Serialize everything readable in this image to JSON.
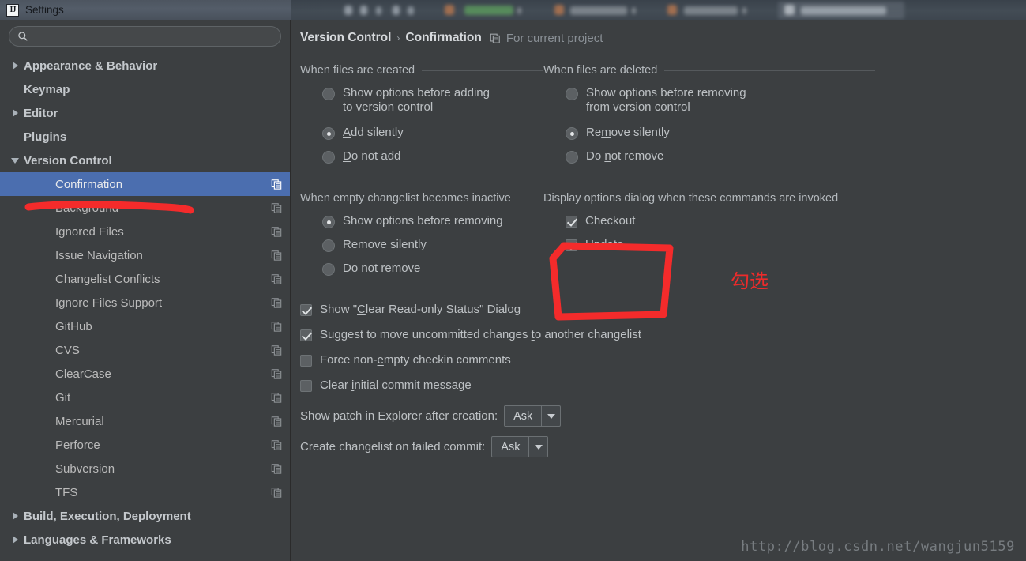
{
  "window": {
    "title": "Settings",
    "app_icon": "IJ"
  },
  "search": {
    "value": "",
    "placeholder": ""
  },
  "sidebar": {
    "items": [
      {
        "label": "Appearance & Behavior",
        "level": 0,
        "group": true,
        "twisty": "collapsed",
        "selected": false,
        "icon": false
      },
      {
        "label": "Keymap",
        "level": 0,
        "group": true,
        "twisty": "none",
        "selected": false,
        "icon": false
      },
      {
        "label": "Editor",
        "level": 0,
        "group": true,
        "twisty": "collapsed",
        "selected": false,
        "icon": false
      },
      {
        "label": "Plugins",
        "level": 0,
        "group": true,
        "twisty": "none",
        "selected": false,
        "icon": false
      },
      {
        "label": "Version Control",
        "level": 0,
        "group": true,
        "twisty": "expanded",
        "selected": false,
        "icon": false
      },
      {
        "label": "Confirmation",
        "level": 1,
        "group": false,
        "twisty": "none",
        "selected": true,
        "icon": true
      },
      {
        "label": "Background",
        "level": 1,
        "group": false,
        "twisty": "none",
        "selected": false,
        "icon": true
      },
      {
        "label": "Ignored Files",
        "level": 1,
        "group": false,
        "twisty": "none",
        "selected": false,
        "icon": true
      },
      {
        "label": "Issue Navigation",
        "level": 1,
        "group": false,
        "twisty": "none",
        "selected": false,
        "icon": true
      },
      {
        "label": "Changelist Conflicts",
        "level": 1,
        "group": false,
        "twisty": "none",
        "selected": false,
        "icon": true
      },
      {
        "label": "Ignore Files Support",
        "level": 1,
        "group": false,
        "twisty": "none",
        "selected": false,
        "icon": true
      },
      {
        "label": "GitHub",
        "level": 1,
        "group": false,
        "twisty": "none",
        "selected": false,
        "icon": true
      },
      {
        "label": "CVS",
        "level": 1,
        "group": false,
        "twisty": "none",
        "selected": false,
        "icon": true
      },
      {
        "label": "ClearCase",
        "level": 1,
        "group": false,
        "twisty": "none",
        "selected": false,
        "icon": true
      },
      {
        "label": "Git",
        "level": 1,
        "group": false,
        "twisty": "none",
        "selected": false,
        "icon": true
      },
      {
        "label": "Mercurial",
        "level": 1,
        "group": false,
        "twisty": "none",
        "selected": false,
        "icon": true
      },
      {
        "label": "Perforce",
        "level": 1,
        "group": false,
        "twisty": "none",
        "selected": false,
        "icon": true
      },
      {
        "label": "Subversion",
        "level": 1,
        "group": false,
        "twisty": "none",
        "selected": false,
        "icon": true
      },
      {
        "label": "TFS",
        "level": 1,
        "group": false,
        "twisty": "none",
        "selected": false,
        "icon": true
      },
      {
        "label": "Build, Execution, Deployment",
        "level": 0,
        "group": true,
        "twisty": "collapsed",
        "selected": false,
        "icon": false
      },
      {
        "label": "Languages & Frameworks",
        "level": 0,
        "group": true,
        "twisty": "collapsed",
        "selected": false,
        "icon": false
      }
    ]
  },
  "breadcrumb": {
    "root": "Version Control",
    "separator": "›",
    "leaf": "Confirmation",
    "scope_note": "For current project"
  },
  "sections": {
    "files_created": {
      "title": "When files are created",
      "has_rule": true,
      "options": [
        {
          "label": "Show options before adding to version control",
          "checked": false,
          "mnemonic": ""
        },
        {
          "label": "Add silently",
          "checked": true,
          "mnemonic": "A"
        },
        {
          "label": "Do not add",
          "checked": false,
          "mnemonic": "D"
        }
      ]
    },
    "files_deleted": {
      "title": "When files are deleted",
      "has_rule": true,
      "options": [
        {
          "label": "Show options before removing from version control",
          "checked": false,
          "mnemonic": ""
        },
        {
          "label": "Remove silently",
          "checked": true,
          "mnemonic": "m"
        },
        {
          "label": "Do not remove",
          "checked": false,
          "mnemonic": "n"
        }
      ]
    },
    "empty_changelist": {
      "title": "When empty changelist becomes inactive",
      "has_rule": false,
      "options": [
        {
          "label": "Show options before removing",
          "checked": true
        },
        {
          "label": "Remove silently",
          "checked": false
        },
        {
          "label": "Do not remove",
          "checked": false
        }
      ]
    },
    "display_options": {
      "title": "Display options dialog when these commands are invoked",
      "has_rule": false,
      "options": [
        {
          "label": "Checkout",
          "checked": true
        },
        {
          "label": "Update",
          "checked": true
        }
      ]
    }
  },
  "checkboxes": [
    {
      "label": "Show \"Clear Read-only Status\" Dialog",
      "checked": true
    },
    {
      "label": "Suggest to move uncommitted changes to another changelist",
      "checked": true
    },
    {
      "label": "Force non-empty checkin comments",
      "checked": false
    },
    {
      "label": "Clear initial commit message",
      "checked": false
    }
  ],
  "selects": [
    {
      "label": "Show patch in Explorer after creation:",
      "value": "Ask"
    },
    {
      "label": "Create changelist on failed commit:",
      "value": "Ask"
    }
  ],
  "annotations": {
    "note_text": "勾选",
    "ink_color": "#f42b2b"
  },
  "watermark": "http://blog.csdn.net/wangjun5159",
  "colors": {
    "dialog_bg": "#3c3f41",
    "selection_blue": "#4b6eaf",
    "text_primary": "#bdc1c4",
    "text_muted": "#8a9096",
    "annotation_red": "#f42b2b"
  }
}
